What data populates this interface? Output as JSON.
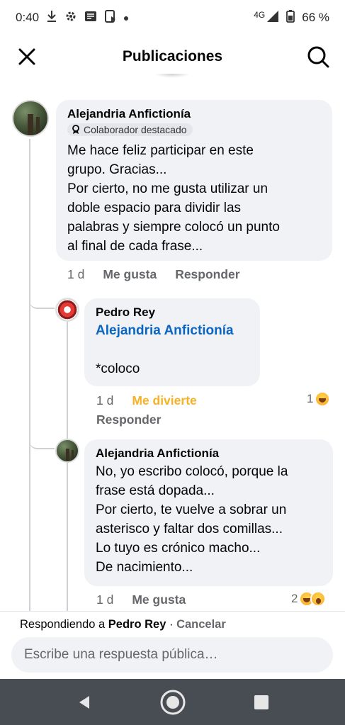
{
  "status_bar": {
    "time": "0:40",
    "network": "4G",
    "battery": "66 %",
    "icons": [
      "download-icon",
      "settings-icon",
      "message-icon",
      "screen-cast-icon",
      "dot-icon",
      "signal-icon",
      "battery-icon"
    ]
  },
  "header": {
    "title": "Publicaciones",
    "close_icon": "close-icon",
    "search_icon": "search-icon"
  },
  "comments": [
    {
      "author": "Alejandria Anfictionía",
      "badge": "Colaborador destacado",
      "text": "Me hace feliz participar en este\ngrupo. Gracias...\nPor cierto, no me gusta utilizar un\ndoble espacio para dividir las\npalabras y siempre colocó un punto\nal final de cada frase...",
      "time": "1 d",
      "like_label": "Me gusta",
      "reply_label": "Responder"
    },
    {
      "author": "Pedro Rey",
      "mention": "Alejandria Anfictionía",
      "text": "*coloco",
      "time": "1 d",
      "reaction_label": "Me divierte",
      "reply_label": "Responder",
      "reaction_count": "1"
    },
    {
      "author": "Alejandria Anfictionía",
      "text": "No, yo escribo colocó, porque la\nfrase está dopada...\nPor cierto, te vuelve a sobrar un\nasterisco y faltar dos comillas...\nLo tuyo es crónico macho...\nDe nacimiento...",
      "time": "1 d",
      "like_label": "Me gusta",
      "reaction_count": "2"
    }
  ],
  "reply_bar": {
    "prefix": "Respondiendo a ",
    "target": "Pedro Rey",
    "separator": " · ",
    "cancel": "Cancelar",
    "placeholder": "Escribe una respuesta pública…"
  },
  "nav_bar": {
    "icons": [
      "back-icon",
      "home-icon",
      "recents-icon"
    ]
  },
  "colors": {
    "bubble": "#f0f2f5",
    "link": "#0a66c2",
    "haha": "#f7b125",
    "nav": "#474d52"
  }
}
